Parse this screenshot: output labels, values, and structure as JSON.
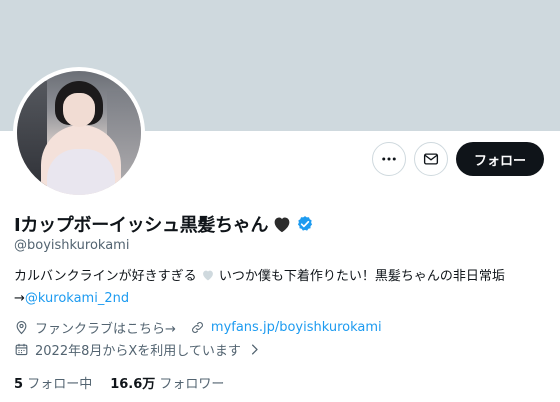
{
  "profile": {
    "display_name": "Iカップボーイッシュ黒髪ちゃん",
    "handle": "@boyishkurokami",
    "bio_part1": "カルバンクラインが好きすぎる",
    "bio_part2": " いつか僕も下着作りたい！黒髪ちゃんの非日常垢",
    "bio_arrow": "→",
    "bio_link": "@kurokami_2nd",
    "location": "ファンクラブはこちら→",
    "website": "myfans.jp/boyishkurokami",
    "joined": "2022年8月からXを利用しています",
    "following_count": "5",
    "following_label": "フォロー中",
    "followers_count": "16.6万",
    "followers_label": "フォロワー"
  },
  "actions": {
    "follow_label": "フォロー"
  },
  "icons": {
    "more": "more-icon",
    "message": "envelope-icon",
    "verified": "verified-badge-icon",
    "heart": "black-heart-icon",
    "location": "location-pin-icon",
    "link": "link-icon",
    "calendar": "calendar-icon"
  },
  "colors": {
    "banner": "#cfd9de",
    "accent": "#1d9bf0",
    "text": "#0f1419",
    "muted": "#536471",
    "follow_bg": "#0f1419"
  }
}
